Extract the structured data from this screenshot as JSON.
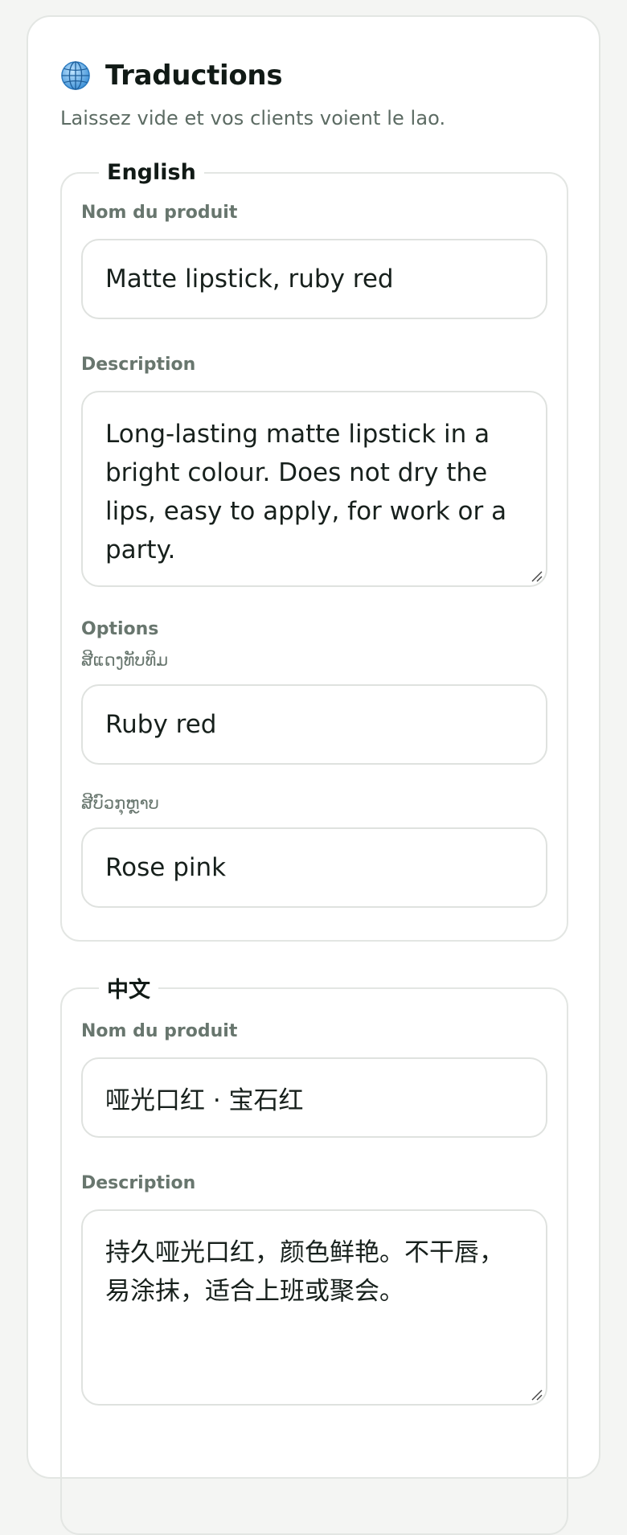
{
  "header": {
    "icon": "globe-icon",
    "title": "Traductions",
    "subtitle": "Laissez vide et vos clients voient le lao."
  },
  "languages": [
    {
      "legend": "English",
      "name_label": "Nom du produit",
      "name_value": "Matte lipstick, ruby red",
      "description_label": "Description",
      "description_value": "Long-lasting matte lipstick in a bright colour. Does not dry the lips, easy to apply, for work or a party.",
      "options_label": "Options",
      "options": [
        {
          "label": "ສີແດງທັບທິມ",
          "value": "Ruby red"
        },
        {
          "label": "ສີບົວກຸຫຼາບ",
          "value": "Rose pink"
        }
      ]
    },
    {
      "legend": "中文",
      "name_label": "Nom du produit",
      "name_value": "哑光口红 · 宝石红",
      "description_label": "Description",
      "description_value": "持久哑光口红，颜色鲜艳。不干唇，易涂抹，适合上班或聚会。"
    }
  ],
  "colors": {
    "background": "#f4f5f3",
    "card": "#ffffff",
    "border": "#e3e6e3",
    "text": "#17201c",
    "muted": "#68766e"
  }
}
